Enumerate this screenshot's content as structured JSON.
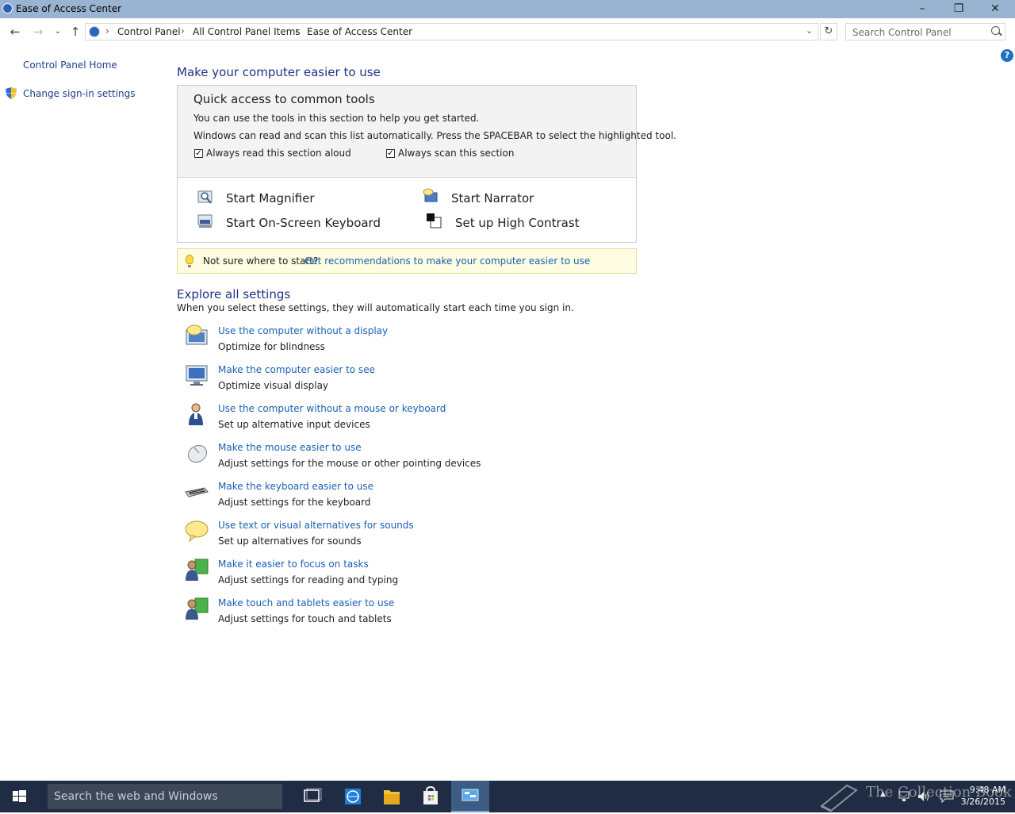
{
  "window": {
    "title": "Ease of Access Center",
    "minimize_glyph": "–",
    "maximize_glyph": "❐",
    "close_glyph": "✕"
  },
  "address_bar": {
    "breadcrumbs": [
      "Control Panel",
      "All Control Panel Items",
      "Ease of Access Center"
    ],
    "search_placeholder": "Search Control Panel"
  },
  "help_label": "?",
  "left_nav": {
    "items": [
      {
        "label": "Control Panel Home"
      },
      {
        "label": "Change sign-in settings",
        "icon": "shield-icon"
      }
    ]
  },
  "main": {
    "heading": "Make your computer easier to use",
    "quick_access": {
      "title": "Quick access to common tools",
      "line1": "You can use the tools in this section to help you get started.",
      "line2": "Windows can read and scan this list automatically.  Press the SPACEBAR to select the highlighted tool.",
      "checkboxes": [
        {
          "label": "Always read this section aloud",
          "checked": true
        },
        {
          "label": "Always scan this section",
          "checked": true
        }
      ],
      "tools": [
        {
          "label": "Start Magnifier",
          "icon": "magnifier-icon"
        },
        {
          "label": "Start Narrator",
          "icon": "narrator-icon"
        },
        {
          "label": "Start On-Screen Keyboard",
          "icon": "onscreen-keyboard-icon"
        },
        {
          "label": "Set up High Contrast",
          "icon": "high-contrast-icon"
        }
      ]
    },
    "hint": {
      "text": "Not sure where to start?",
      "link": "Get recommendations to make your computer easier to use"
    },
    "explore": {
      "heading": "Explore all settings",
      "subtitle": "When you select these settings, they will automatically start each time you sign in.",
      "items": [
        {
          "link": "Use the computer without a display",
          "desc": "Optimize for blindness",
          "icon": "no-display-icon"
        },
        {
          "link": "Make the computer easier to see",
          "desc": "Optimize visual display",
          "icon": "monitor-icon"
        },
        {
          "link": "Use the computer without a mouse or keyboard",
          "desc": "Set up alternative input devices",
          "icon": "person-icon"
        },
        {
          "link": "Make the mouse easier to use",
          "desc": "Adjust settings for the mouse or other pointing devices",
          "icon": "mouse-icon"
        },
        {
          "link": "Make the keyboard easier to use",
          "desc": "Adjust settings for the keyboard",
          "icon": "keyboard-icon"
        },
        {
          "link": "Use text or visual alternatives for sounds",
          "desc": "Set up alternatives for sounds",
          "icon": "speech-bubble-icon"
        },
        {
          "link": "Make it easier to focus on tasks",
          "desc": "Adjust settings for reading and typing",
          "icon": "focus-user-icon"
        },
        {
          "link": "Make touch and tablets easier to use",
          "desc": "Adjust settings for touch and tablets",
          "icon": "touch-user-icon"
        }
      ]
    }
  },
  "taskbar": {
    "search_placeholder": "Search the web and Windows",
    "watermark": "The Collection Book",
    "time": "9:48 AM",
    "date": "3/26/2015"
  }
}
